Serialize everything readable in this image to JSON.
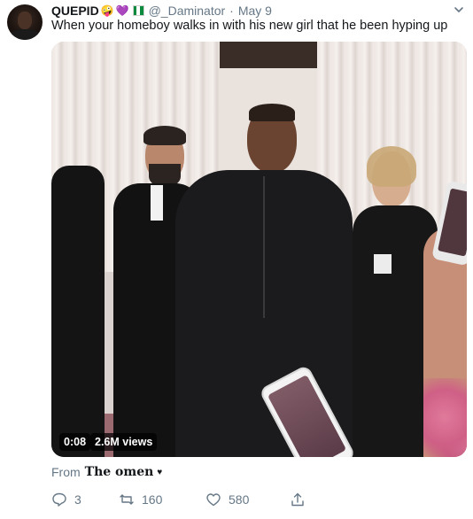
{
  "tweet": {
    "display_name": "QUEPID",
    "name_emoji": [
      "🤪",
      "💜"
    ],
    "flag_colors": [
      "#0b8a3e",
      "#ffffff",
      "#0b8a3e"
    ],
    "handle": "@_Daminator",
    "separator": "·",
    "date": "May 9",
    "text": "When your homeboy walks in with his new girl that he been hyping up"
  },
  "icons": {
    "more": "chevron-down-icon",
    "reply": "reply-icon",
    "retweet": "retweet-icon",
    "like": "heart-icon",
    "share": "share-icon"
  },
  "media": {
    "time": "0:08",
    "views": "2.6M views"
  },
  "source": {
    "label": "From",
    "account": "The omen"
  },
  "actions": {
    "reply_count": "3",
    "retweet_count": "160",
    "like_count": "580"
  },
  "colors": {
    "text": "#14171a",
    "secondary": "#657786",
    "badge_bg": "#000000"
  }
}
